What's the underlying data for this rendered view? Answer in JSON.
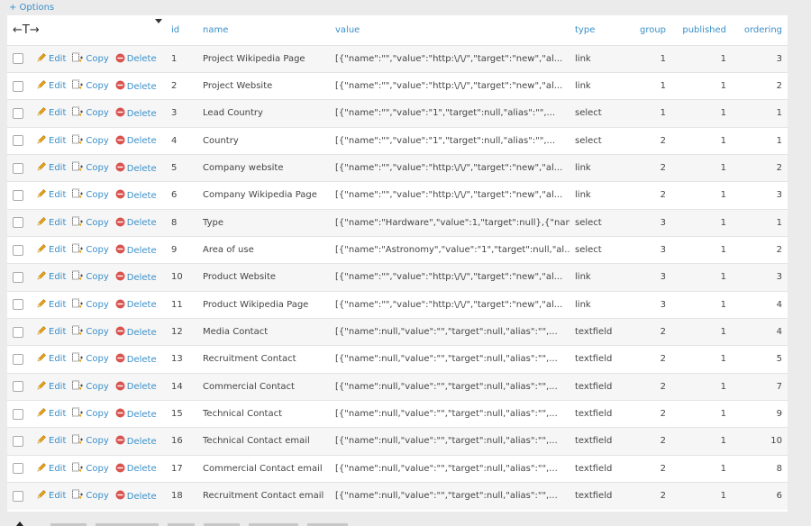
{
  "options_label": "+ Options",
  "columns": {
    "move": "←T→",
    "id": "id",
    "name": "name",
    "value": "value",
    "type": "type",
    "group": "group",
    "published": "published",
    "ordering": "ordering"
  },
  "actions": {
    "edit": "Edit",
    "copy": "Copy",
    "delete": "Delete"
  },
  "colors": {
    "link": "#3a8fc9",
    "row_alt": "#f6f6f6",
    "delete_icon": "#d9534f",
    "edit_icon": "#e6a21a"
  },
  "rows": [
    {
      "id": "1",
      "name": "Project Wikipedia Page",
      "value": "[{\"name\":\"\",\"value\":\"http:\\/\\/\",\"target\":\"new\",\"al...",
      "type": "link",
      "group": "1",
      "published": "1",
      "ordering": "3"
    },
    {
      "id": "2",
      "name": "Project Website",
      "value": "[{\"name\":\"\",\"value\":\"http:\\/\\/\",\"target\":\"new\",\"al...",
      "type": "link",
      "group": "1",
      "published": "1",
      "ordering": "2"
    },
    {
      "id": "3",
      "name": "Lead Country",
      "value": "[{\"name\":\"\",\"value\":\"1\",\"target\":null,\"alias\":\"\",...",
      "type": "select",
      "group": "1",
      "published": "1",
      "ordering": "1"
    },
    {
      "id": "4",
      "name": "Country",
      "value": "[{\"name\":\"\",\"value\":\"1\",\"target\":null,\"alias\":\"\",...",
      "type": "select",
      "group": "2",
      "published": "1",
      "ordering": "1"
    },
    {
      "id": "5",
      "name": "Company website",
      "value": "[{\"name\":\"\",\"value\":\"http:\\/\\/\",\"target\":\"new\",\"al...",
      "type": "link",
      "group": "2",
      "published": "1",
      "ordering": "2"
    },
    {
      "id": "6",
      "name": "Company Wikipedia Page",
      "value": "[{\"name\":\"\",\"value\":\"http:\\/\\/\",\"target\":\"new\",\"al...",
      "type": "link",
      "group": "2",
      "published": "1",
      "ordering": "3"
    },
    {
      "id": "8",
      "name": "Type",
      "value": "[{\"name\":\"Hardware\",\"value\":1,\"target\":null},{\"nam...",
      "type": "select",
      "group": "3",
      "published": "1",
      "ordering": "1"
    },
    {
      "id": "9",
      "name": "Area of use",
      "value": "[{\"name\":\"Astronomy\",\"value\":\"1\",\"target\":null,\"al...",
      "type": "select",
      "group": "3",
      "published": "1",
      "ordering": "2"
    },
    {
      "id": "10",
      "name": "Product Website",
      "value": "[{\"name\":\"\",\"value\":\"http:\\/\\/\",\"target\":\"new\",\"al...",
      "type": "link",
      "group": "3",
      "published": "1",
      "ordering": "3"
    },
    {
      "id": "11",
      "name": "Product Wikipedia Page",
      "value": "[{\"name\":\"\",\"value\":\"http:\\/\\/\",\"target\":\"new\",\"al...",
      "type": "link",
      "group": "3",
      "published": "1",
      "ordering": "4"
    },
    {
      "id": "12",
      "name": "Media Contact",
      "value": "[{\"name\":null,\"value\":\"\",\"target\":null,\"alias\":\"\",...",
      "type": "textfield",
      "group": "2",
      "published": "1",
      "ordering": "4"
    },
    {
      "id": "13",
      "name": "Recruitment Contact",
      "value": "[{\"name\":null,\"value\":\"\",\"target\":null,\"alias\":\"\",...",
      "type": "textfield",
      "group": "2",
      "published": "1",
      "ordering": "5"
    },
    {
      "id": "14",
      "name": "Commercial Contact",
      "value": "[{\"name\":null,\"value\":\"\",\"target\":null,\"alias\":\"\",...",
      "type": "textfield",
      "group": "2",
      "published": "1",
      "ordering": "7"
    },
    {
      "id": "15",
      "name": "Technical Contact",
      "value": "[{\"name\":null,\"value\":\"\",\"target\":null,\"alias\":\"\",...",
      "type": "textfield",
      "group": "2",
      "published": "1",
      "ordering": "9"
    },
    {
      "id": "16",
      "name": "Technical Contact email",
      "value": "[{\"name\":null,\"value\":\"\",\"target\":null,\"alias\":\"\",...",
      "type": "textfield",
      "group": "2",
      "published": "1",
      "ordering": "10"
    },
    {
      "id": "17",
      "name": "Commercial Contact email",
      "value": "[{\"name\":null,\"value\":\"\",\"target\":null,\"alias\":\"\",...",
      "type": "textfield",
      "group": "2",
      "published": "1",
      "ordering": "8"
    },
    {
      "id": "18",
      "name": "Recruitment Contact email",
      "value": "[{\"name\":null,\"value\":\"\",\"target\":null,\"alias\":\"\",...",
      "type": "textfield",
      "group": "2",
      "published": "1",
      "ordering": "6"
    }
  ]
}
